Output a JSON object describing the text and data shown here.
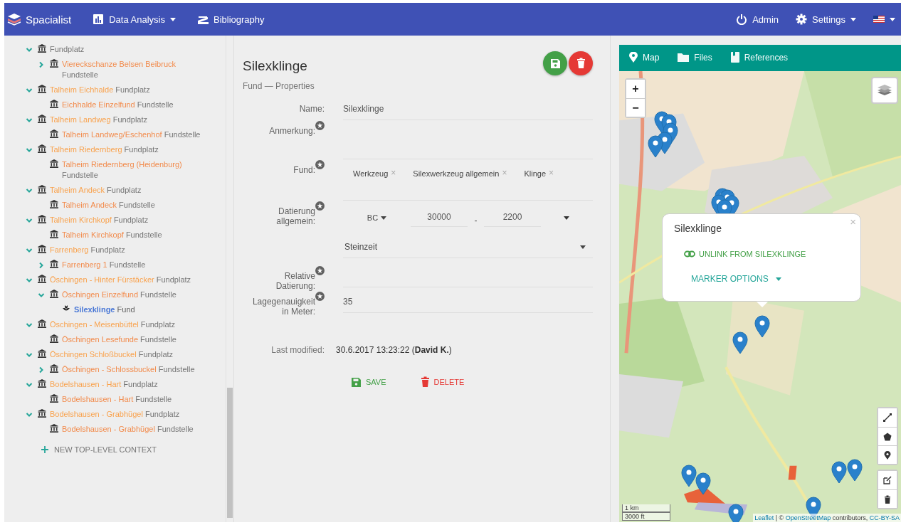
{
  "navbar": {
    "brand": "Spacialist",
    "menu": [
      {
        "label": "Data Analysis",
        "kind": "chart",
        "dropdown": true
      },
      {
        "label": "Bibliography",
        "kind": "books",
        "dropdown": false
      }
    ],
    "right": [
      {
        "label": "Admin",
        "kind": "power",
        "dropdown": false
      },
      {
        "label": "Settings",
        "kind": "gear",
        "dropdown": true
      },
      {
        "kind": "flag",
        "dropdown": true
      }
    ]
  },
  "tree": {
    "items": [
      {
        "type": "Fundplatz",
        "kind": "context",
        "selected": false,
        "expanded": true,
        "children": [
          {
            "name": "Viereckschanze Belsen Beibruck",
            "type": "Fundstelle",
            "kind": "context",
            "selected": false,
            "expanded": false
          }
        ]
      },
      {
        "name": "Talheim Eichhalde",
        "type": "Fundplatz",
        "kind": "context",
        "selected": false,
        "expanded": true,
        "children": [
          {
            "name": "Eichhalde Einzelfund",
            "type": "Fundstelle",
            "kind": "context",
            "selected": false
          }
        ]
      },
      {
        "name": "Talheim Landweg",
        "type": "Fundplatz",
        "kind": "context",
        "selected": false,
        "expanded": true,
        "children": [
          {
            "name": "Talheim Landweg/Eschenhof",
            "type": "Fundstelle",
            "kind": "context",
            "selected": false
          }
        ]
      },
      {
        "name": "Talheim Riedernberg",
        "type": "Fundplatz",
        "kind": "context",
        "selected": false,
        "expanded": true,
        "children": [
          {
            "name": "Talheim Riedernberg (Heidenburg)",
            "type": "Fundstelle",
            "kind": "context",
            "selected": false
          }
        ]
      },
      {
        "name": "Talheim Andeck",
        "type": "Fundplatz",
        "kind": "context",
        "selected": false,
        "expanded": true,
        "children": [
          {
            "name": "Talheim Andeck",
            "type": "Fundstelle",
            "kind": "context",
            "selected": false
          }
        ]
      },
      {
        "name": "Talheim Kirchkopf",
        "type": "Fundplatz",
        "kind": "context",
        "selected": false,
        "expanded": true,
        "children": [
          {
            "name": "Talheim Kirchkopf",
            "type": "Fundstelle",
            "kind": "context",
            "selected": false
          }
        ]
      },
      {
        "name": "Farrenberg",
        "type": "Fundplatz",
        "kind": "context",
        "selected": false,
        "expanded": true,
        "children": [
          {
            "name": "Farrenberg 1",
            "type": "Fundstelle",
            "kind": "context",
            "selected": false,
            "expanded": false
          }
        ]
      },
      {
        "name": "Öschingen - Hinter Fürstäcker",
        "type": "Fundplatz",
        "kind": "context",
        "selected": false,
        "expanded": true,
        "children": [
          {
            "name": "Öschingen Einzelfund",
            "type": "Fundstelle",
            "kind": "context",
            "selected": false,
            "expanded": true,
            "children": [
              {
                "name": "Silexklinge",
                "type": "Fund",
                "kind": "find",
                "selected": true
              }
            ]
          }
        ]
      },
      {
        "name": "Öschingen - Meisenbüttel",
        "type": "Fundplatz",
        "kind": "context",
        "selected": false,
        "expanded": true,
        "children": [
          {
            "name": "Öschingen Lesefunde",
            "type": "Fundstelle",
            "kind": "context",
            "selected": false
          }
        ]
      },
      {
        "name": "Öschingen Schloßbuckel",
        "type": "Fundplatz",
        "kind": "context",
        "selected": false,
        "expanded": true,
        "children": [
          {
            "name": "Öschingen - Schlossbuckel",
            "type": "Fundstelle",
            "kind": "context",
            "selected": false,
            "expanded": false
          }
        ]
      },
      {
        "name": "Bodelshausen - Hart",
        "type": "Fundplatz",
        "kind": "context",
        "selected": false,
        "expanded": true,
        "children": [
          {
            "name": "Bodelshausen - Hart",
            "type": "Fundstelle",
            "kind": "context",
            "selected": false
          }
        ]
      },
      {
        "name": "Bodelshausen - Grabhügel",
        "type": "Fundplatz",
        "kind": "context",
        "selected": false,
        "expanded": true,
        "children": [
          {
            "name": "Bodelshausen - Grabhügel",
            "type": "Fundstelle",
            "kind": "context",
            "selected": false
          }
        ]
      }
    ],
    "new_button": "NEW TOP-LEVEL CONTEXT"
  },
  "detail": {
    "title": "Silexklinge",
    "subtitle": "Fund — Properties",
    "fields": [
      {
        "kind": "text",
        "label": "Name:",
        "starred": false,
        "value": "Silexklinge"
      },
      {
        "kind": "textarea",
        "label": "Anmerkung:",
        "starred": true
      },
      {
        "kind": "tags",
        "label": "Fund:",
        "starred": true,
        "tags": [
          "Werkzeug",
          "Silexwerkzeug allgemein",
          "Klinge"
        ],
        "remove": "×"
      },
      {
        "kind": "dating",
        "label": "Datierung allgemein:",
        "starred": true,
        "era": "BC",
        "from": "30000",
        "separator": "-",
        "to": "2200"
      },
      {
        "kind": "select",
        "value": "Steinzeit"
      },
      {
        "kind": "text",
        "label": "Relative Datierung:",
        "starred": true
      },
      {
        "kind": "text",
        "label": "Lagegenauigkeit in Meter:",
        "starred": true,
        "value": "35"
      }
    ],
    "last_modified": {
      "label": "Last modified:",
      "value": "30.6.2017 13:23:22 (**David K.**)"
    },
    "actions": [
      {
        "kind": "save",
        "label": "SAVE"
      },
      {
        "kind": "delete",
        "label": "DELETE"
      }
    ]
  },
  "map_panel": {
    "tabs": [
      {
        "label": "Map",
        "kind": "pin",
        "selected": true
      },
      {
        "label": "Files",
        "kind": "folder",
        "selected": false
      },
      {
        "label": "References",
        "kind": "book",
        "selected": false
      }
    ],
    "zoom": [
      "+",
      "−"
    ],
    "popup": {
      "title": "Silexklinge",
      "close": "×",
      "link": "UNLINK FROM SILEXKLINGE",
      "options": "MARKER OPTIONS"
    },
    "scale": [
      "1 km",
      "3000 ft"
    ],
    "attribution": [
      {
        "kind": "link",
        "text": "Leaflet"
      },
      {
        "kind": "text",
        "text": " | © "
      },
      {
        "kind": "link",
        "text": "OpenStreetMap"
      },
      {
        "kind": "text",
        "text": " contributors, "
      },
      {
        "kind": "link",
        "text": "CC-BY-SA"
      }
    ]
  }
}
